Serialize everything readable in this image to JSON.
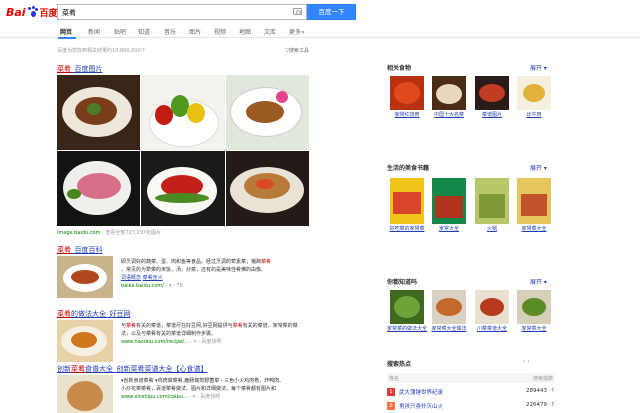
{
  "header": {
    "logo_left": "Bai",
    "logo_right": "百度",
    "query": "菜肴",
    "search_button": "百度一下"
  },
  "tabs": [
    "网页",
    "新闻",
    "贴吧",
    "知道",
    "音乐",
    "图片",
    "视频",
    "地图",
    "文库",
    "更多»"
  ],
  "result_count": "百度为您找到相关结果约10,800,000个",
  "search_tools": "搜索工具",
  "results": [
    {
      "title_em": "菜肴",
      "title_rest": "_百度图片",
      "url": "image.baidu.com",
      "more": "- 查看全部727,297张图片"
    },
    {
      "title_em": "菜肴",
      "title_rest": "_百度百科",
      "text_1": "即烹调好的蔬菜、蛋、肉和鱼等食品。经过烹调的荤素菜；猪蹄",
      "text_1_em": "菜肴",
      "text_2": "，常见的为荤菜的米饭，汤，炒菜，还有的是美味佳肴佛的由像。",
      "link_1": "词语概念",
      "link_2": "菜肴含义",
      "url": "baike.baidu.com/",
      "url_arrow": "- ▾ - 76"
    },
    {
      "title_em": "菜肴",
      "title_rest": "的做法大全_好豆网",
      "text_pre": "与",
      "text_em_1": "菜肴",
      "text_mid": "有关的菜谱，菜谱尽在好豆网,好豆网提供与",
      "text_em_2": "菜肴",
      "text_post": "有关的菜谱，家常菜的做法，以及与菜肴有关的菜谱详细制作步骤。",
      "url": "www.haodou.com/recipe/...",
      "url_suffix": "- ▾ - 百度快照"
    },
    {
      "title_pre": "创新",
      "title_em": "菜肴",
      "title_rest": "食谱大全_创新菜肴菜谱大全【心食谱】",
      "text_1": "▾创新食谱菜肴 ▾鸡肉做菜肴,鹿肠做煎野菌菜 - 三色小火鸡肉卷，炸鸭肉、",
      "text_2": "小炒花菜菜肴，百道菜肴做法、图片和详细做法，每个菜肴都有图片和",
      "text_3": "做法，让你轻轻松松做出美味菜肴。",
      "url": "www.xinshipu.com/caipu...",
      "url_suffix": "- ▾ - 百度快照"
    }
  ],
  "rail": {
    "section_1": {
      "title": "相关食物",
      "expand": "展开 ▾",
      "items": [
        "家常红烧肉",
        "中国十大名菜",
        "菜谱图片",
        "炒牛肉"
      ]
    },
    "section_2": {
      "title": "生活的美食书籍",
      "expand": "展开 ▾",
      "items": [
        "好吃菜的家常菜",
        "家常大全",
        "火锅",
        "家常菜大全"
      ]
    },
    "section_3": {
      "title": "你都知道吗",
      "expand": "展开 ▾",
      "items": [
        "家常菜的做法大全",
        "家常菜大全做法",
        "川菜菜谱大全",
        "家常菜大全"
      ]
    },
    "hot": {
      "title": "搜索热点",
      "nav": "‹ ›",
      "head_left": "排名",
      "head_right": "搜索指数",
      "rows": [
        {
          "rank": "1",
          "text": "武大蒲锤世界纪录",
          "value": "289443",
          "color": "#e53935"
        },
        {
          "rank": "2",
          "text": "男孩只身扑灭山火",
          "value": "226479",
          "color": "#ff7043"
        }
      ]
    }
  }
}
